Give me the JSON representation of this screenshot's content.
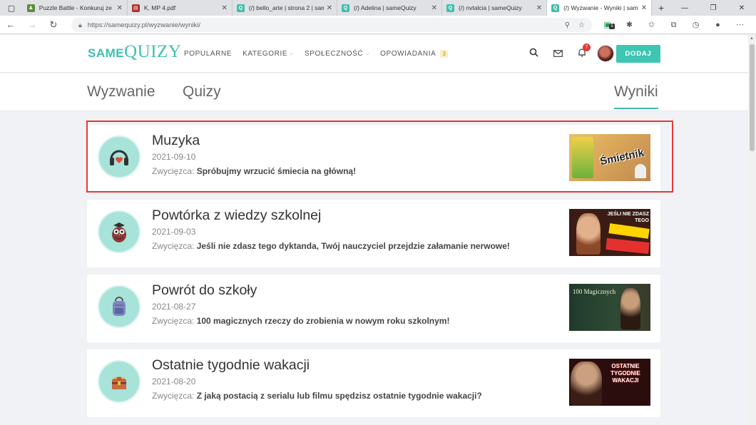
{
  "browser": {
    "tabs": [
      {
        "title": "Puzzle Battle - Konkuruj ze",
        "fav_color": "#5a8f3a"
      },
      {
        "title": "K, MP 4.pdf",
        "fav_color": "#b03030"
      },
      {
        "title": "(/) bello_arte | strona 2 | sam",
        "fav_color": "#3fbfad"
      },
      {
        "title": "(/) Adelina | sameQuizy",
        "fav_color": "#3fbfad"
      },
      {
        "title": "(/) nvtalcia | sameQuizy",
        "fav_color": "#3fbfad"
      },
      {
        "title": "(/) Wyzwanie - Wyniki | sam",
        "fav_color": "#3fbfad"
      }
    ],
    "url": "https://samequizy.pl/wyzwanie/wyniki/",
    "ext_badge": "5"
  },
  "site": {
    "logo_same": "same",
    "logo_quizy": "Quizy",
    "nav": [
      {
        "label": "POPULARNE",
        "chevron": false
      },
      {
        "label": "KATEGORIE",
        "chevron": true
      },
      {
        "label": "SPOŁECZNOŚĆ",
        "chevron": true
      },
      {
        "label": "OPOWIADANIA",
        "chevron": false,
        "badge": "3"
      }
    ],
    "notif_count": "7",
    "add_button": "DODAJ",
    "accent": "#3fc5b3"
  },
  "subnav": {
    "tab1": "Wyzwanie",
    "tab2": "Quizy",
    "tab3": "Wyniki"
  },
  "winner_label": "Zwycięzca:",
  "cards": [
    {
      "title": "Muzyka",
      "date": "2021-09-10",
      "winner": "Spróbujmy wrzucić śmiecia na główną!",
      "icon": "headphones-icon",
      "thumb_text": "Śmietnik"
    },
    {
      "title": "Powtórka z wiedzy szkolnej",
      "date": "2021-09-03",
      "winner": "Jeśli nie zdasz tego dyktanda, Twój nauczyciel przejdzie załamanie nerwowe!",
      "icon": "owl-icon",
      "thumb_text": "JEŚLI NIE ZDASZ TEGO"
    },
    {
      "title": "Powrót do szkoły",
      "date": "2021-08-27",
      "winner": "100 magicznych rzeczy do zrobienia w nowym roku szkolnym!",
      "icon": "backpack-icon",
      "thumb_text": "100 Magicznych"
    },
    {
      "title": "Ostatnie tygodnie wakacji",
      "date": "2021-08-20",
      "winner": "Z jaką postacią z serialu lub filmu spędzisz ostatnie tygodnie wakacji?",
      "icon": "treasure-chest-icon",
      "thumb_text": "OSTATNIE TYGODNIE WAKACJI"
    }
  ]
}
